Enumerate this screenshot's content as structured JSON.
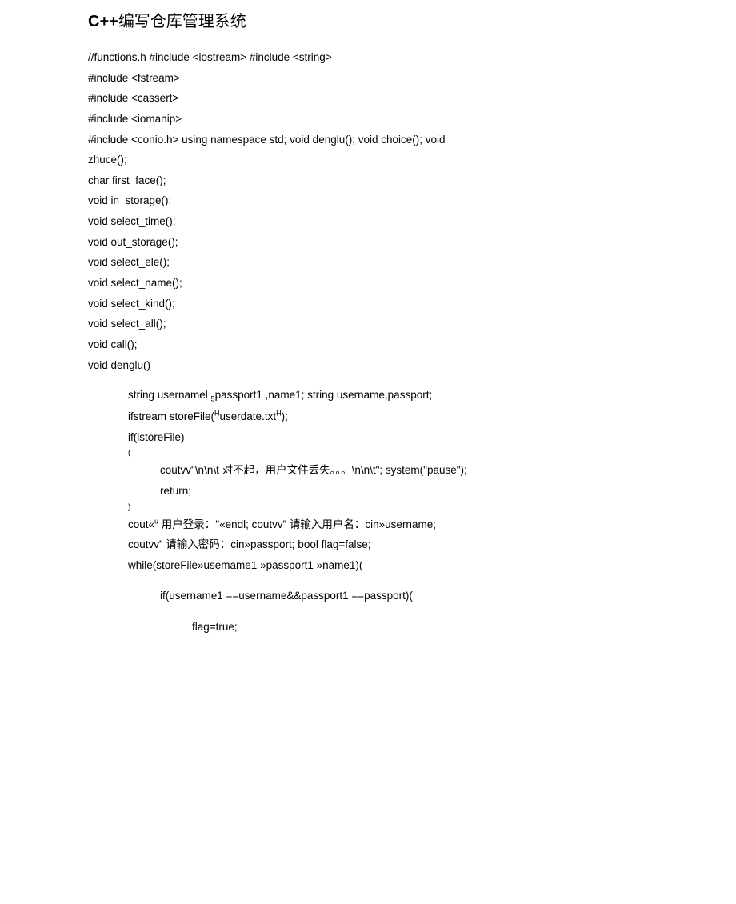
{
  "title_prefix": "C++",
  "title_cjk": "编写仓库管理系统",
  "lines": {
    "l1": "//functions.h #include <iostream> #include <string>",
    "l2": "#include <fstream>",
    "l3": "#include <cassert>",
    "l4": "#include <iomanip>",
    "l5": "#include <conio.h> using namespace std; void denglu(); void choice(); void",
    "l6": "zhuce();",
    "l7": "char first_face();",
    "l8": "void in_storage();",
    "l9": "void select_time();",
    "l10": "void out_storage();",
    "l11": "void select_ele();",
    "l12": "void select_name();",
    "l13": "void select_kind();",
    "l14": "void select_all();",
    "l15": "void call();",
    "l16": "void denglu()"
  },
  "block1": {
    "b1_pre": "string usernamel ",
    "b1_sub": "5",
    "b1_post": "passport1 ,name1; string username,passport;",
    "b2_pre": "ifstream storeFile(",
    "b2_sup1": "H",
    "b2_mid": "userdate.txt",
    "b2_sup2": "H",
    "b2_post": ");",
    "b3": "if(lstoreFile)",
    "brace_open": "(",
    "b4_pre": "coutvv\"\\n\\n\\t ",
    "b4_cjk": "对不起，用户文件丢失。。。",
    "b4_post": "\\n\\n\\t\"; system(\"pause\");",
    "b5": "return;",
    "brace_close": ")",
    "b6_pre": "cout«",
    "b6_sup": "u",
    "b6_mid1": " 用户登录：",
    "b6_mid2": "\"«endl; coutvv” ",
    "b6_cjk2": "请输入用户名：",
    "b6_post": "cin»username;",
    "b7_pre": "coutvv” ",
    "b7_cjk": "请输入密码：",
    "b7_post": "cin»passport; bool flag=false;",
    "b8": "while(storeFile»usemame1 »passport1 »name1)("
  },
  "block2": {
    "c1": "if(username1 ==username&&passport1 ==passport)("
  },
  "block3": {
    "d1": "flag=true;"
  }
}
